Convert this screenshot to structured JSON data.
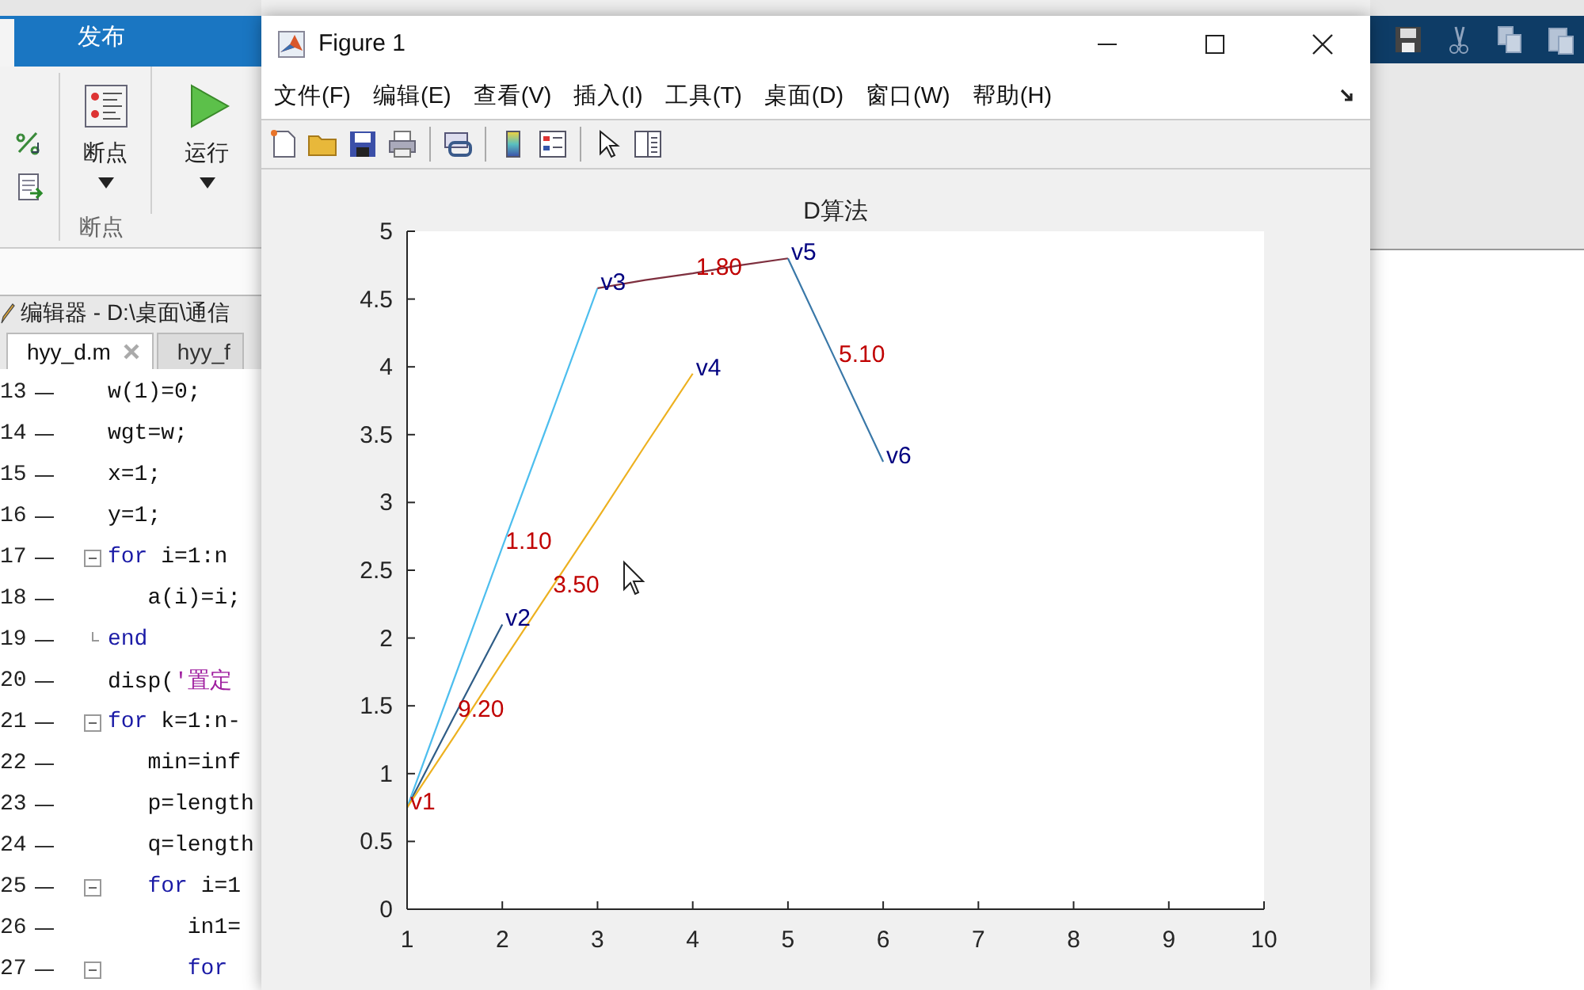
{
  "ribbon": {
    "tabs": [
      {
        "label": "发布",
        "selected": false
      }
    ],
    "buttons": [
      {
        "label": "断点",
        "kind": "breakpoints"
      },
      {
        "label": "运行",
        "kind": "run"
      }
    ],
    "group_label": "断点"
  },
  "editor": {
    "title": "编辑器 - D:\\桌面\\通信",
    "tabs": [
      {
        "label": "hyy_d.m",
        "selected": true
      },
      {
        "label": "hyy_f",
        "selected": false
      }
    ],
    "lines": [
      {
        "number": "13",
        "kind": "plain",
        "tokens": [
          {
            "kind": "plain",
            "text": "w(1)=0;"
          }
        ]
      },
      {
        "number": "14",
        "kind": "plain",
        "tokens": [
          {
            "kind": "plain",
            "text": "wgt=w;"
          }
        ]
      },
      {
        "number": "15",
        "kind": "plain",
        "tokens": [
          {
            "kind": "plain",
            "text": "x=1;"
          }
        ]
      },
      {
        "number": "16",
        "kind": "plain",
        "tokens": [
          {
            "kind": "plain",
            "text": "y=1;"
          }
        ]
      },
      {
        "number": "17",
        "kind": "fold_start",
        "tokens": [
          {
            "kind": "keyword",
            "text": "for"
          },
          {
            "kind": "plain",
            "text": " i=1:n"
          }
        ]
      },
      {
        "number": "18",
        "kind": "plain",
        "tokens": [
          {
            "kind": "plain",
            "text": "   a(i)=i;"
          }
        ]
      },
      {
        "number": "19",
        "kind": "fold_end",
        "tokens": [
          {
            "kind": "keyword",
            "text": "end"
          }
        ]
      },
      {
        "number": "20",
        "kind": "plain",
        "tokens": [
          {
            "kind": "plain",
            "text": "disp("
          },
          {
            "kind": "string",
            "text": "'置定"
          }
        ]
      },
      {
        "number": "21",
        "kind": "fold_start",
        "tokens": [
          {
            "kind": "keyword",
            "text": "for"
          },
          {
            "kind": "plain",
            "text": " k=1:n-"
          }
        ]
      },
      {
        "number": "22",
        "kind": "plain",
        "tokens": [
          {
            "kind": "plain",
            "text": "   min=inf"
          }
        ]
      },
      {
        "number": "23",
        "kind": "plain",
        "tokens": [
          {
            "kind": "plain",
            "text": "   p=length"
          }
        ]
      },
      {
        "number": "24",
        "kind": "plain",
        "tokens": [
          {
            "kind": "plain",
            "text": "   q=length"
          }
        ]
      },
      {
        "number": "25",
        "kind": "fold_start",
        "tokens": [
          {
            "kind": "keyword",
            "text": "   for"
          },
          {
            "kind": "plain",
            "text": " i=1"
          }
        ]
      },
      {
        "number": "26",
        "kind": "plain",
        "tokens": [
          {
            "kind": "plain",
            "text": "      in1="
          }
        ]
      },
      {
        "number": "27",
        "kind": "fold_start",
        "tokens": [
          {
            "kind": "keyword",
            "text": "      for"
          }
        ]
      }
    ]
  },
  "figure": {
    "title": "Figure 1",
    "menu": [
      "文件(F)",
      "编辑(E)",
      "查看(V)",
      "插入(I)",
      "工具(T)",
      "桌面(D)",
      "窗口(W)",
      "帮助(H)"
    ],
    "labels": [
      {
        "color": "#c00000"
      },
      {
        "color": "#000080"
      },
      {
        "color": "#000080"
      },
      {
        "color": "#000080"
      },
      {
        "color": "#000080"
      },
      {
        "color": "#000080"
      },
      {
        "color": "#c00000"
      },
      {
        "color": "#c00000"
      },
      {
        "color": "#c00000"
      },
      {
        "color": "#c00000"
      },
      {
        "color": "#c00000"
      }
    ],
    "chart_data": {
      "type": "line",
      "title": "D算法",
      "x": [
        1,
        1.5,
        2,
        2.5,
        3,
        3.5,
        4,
        4.5,
        5,
        5.5,
        6
      ],
      "series": [
        {
          "color": "#2f5d87",
          "values": [
            0.75,
            1.43,
            2.1,
            null,
            null,
            null,
            null,
            null,
            null,
            null,
            null
          ]
        },
        {
          "color": "#4dbeee",
          "values": [
            0.75,
            1.71,
            2.67,
            3.62,
            4.58,
            null,
            null,
            null,
            null,
            null,
            null
          ]
        },
        {
          "color": "#edb120",
          "values": [
            0.75,
            1.28,
            1.82,
            2.35,
            2.88,
            3.42,
            3.95,
            null,
            null,
            null,
            null
          ]
        },
        {
          "color": "#7e2f3e",
          "values": [
            null,
            null,
            null,
            null,
            4.58,
            4.64,
            4.69,
            4.75,
            4.8,
            null,
            null
          ]
        },
        {
          "color": "#3a78a8",
          "values": [
            null,
            null,
            null,
            null,
            null,
            null,
            null,
            null,
            4.8,
            4.05,
            3.3
          ]
        }
      ],
      "xlim": [
        1,
        10
      ],
      "ylim": [
        0,
        5
      ],
      "xticks": [
        1,
        2,
        3,
        4,
        5,
        6,
        7,
        8,
        9,
        10
      ],
      "yticks": [
        0,
        0.5,
        1,
        1.5,
        2,
        2.5,
        3,
        3.5,
        4,
        4.5,
        5
      ],
      "annotations": [
        {
          "x": 1,
          "y": 0.75,
          "text": "v1"
        },
        {
          "x": 2,
          "y": 2.1,
          "text": "v2"
        },
        {
          "x": 3,
          "y": 4.58,
          "text": "v3"
        },
        {
          "x": 4,
          "y": 3.95,
          "text": "v4"
        },
        {
          "x": 5,
          "y": 4.8,
          "text": "v5"
        },
        {
          "x": 6,
          "y": 3.3,
          "text": "v6"
        },
        {
          "x": 2,
          "y": 2.67,
          "text": "1.10"
        },
        {
          "x": 2.5,
          "y": 2.35,
          "text": "3.50"
        },
        {
          "x": 1.5,
          "y": 1.43,
          "text": "9.20"
        },
        {
          "x": 4,
          "y": 4.69,
          "text": "1.80"
        },
        {
          "x": 5.5,
          "y": 4.05,
          "text": "5.10"
        }
      ]
    }
  }
}
